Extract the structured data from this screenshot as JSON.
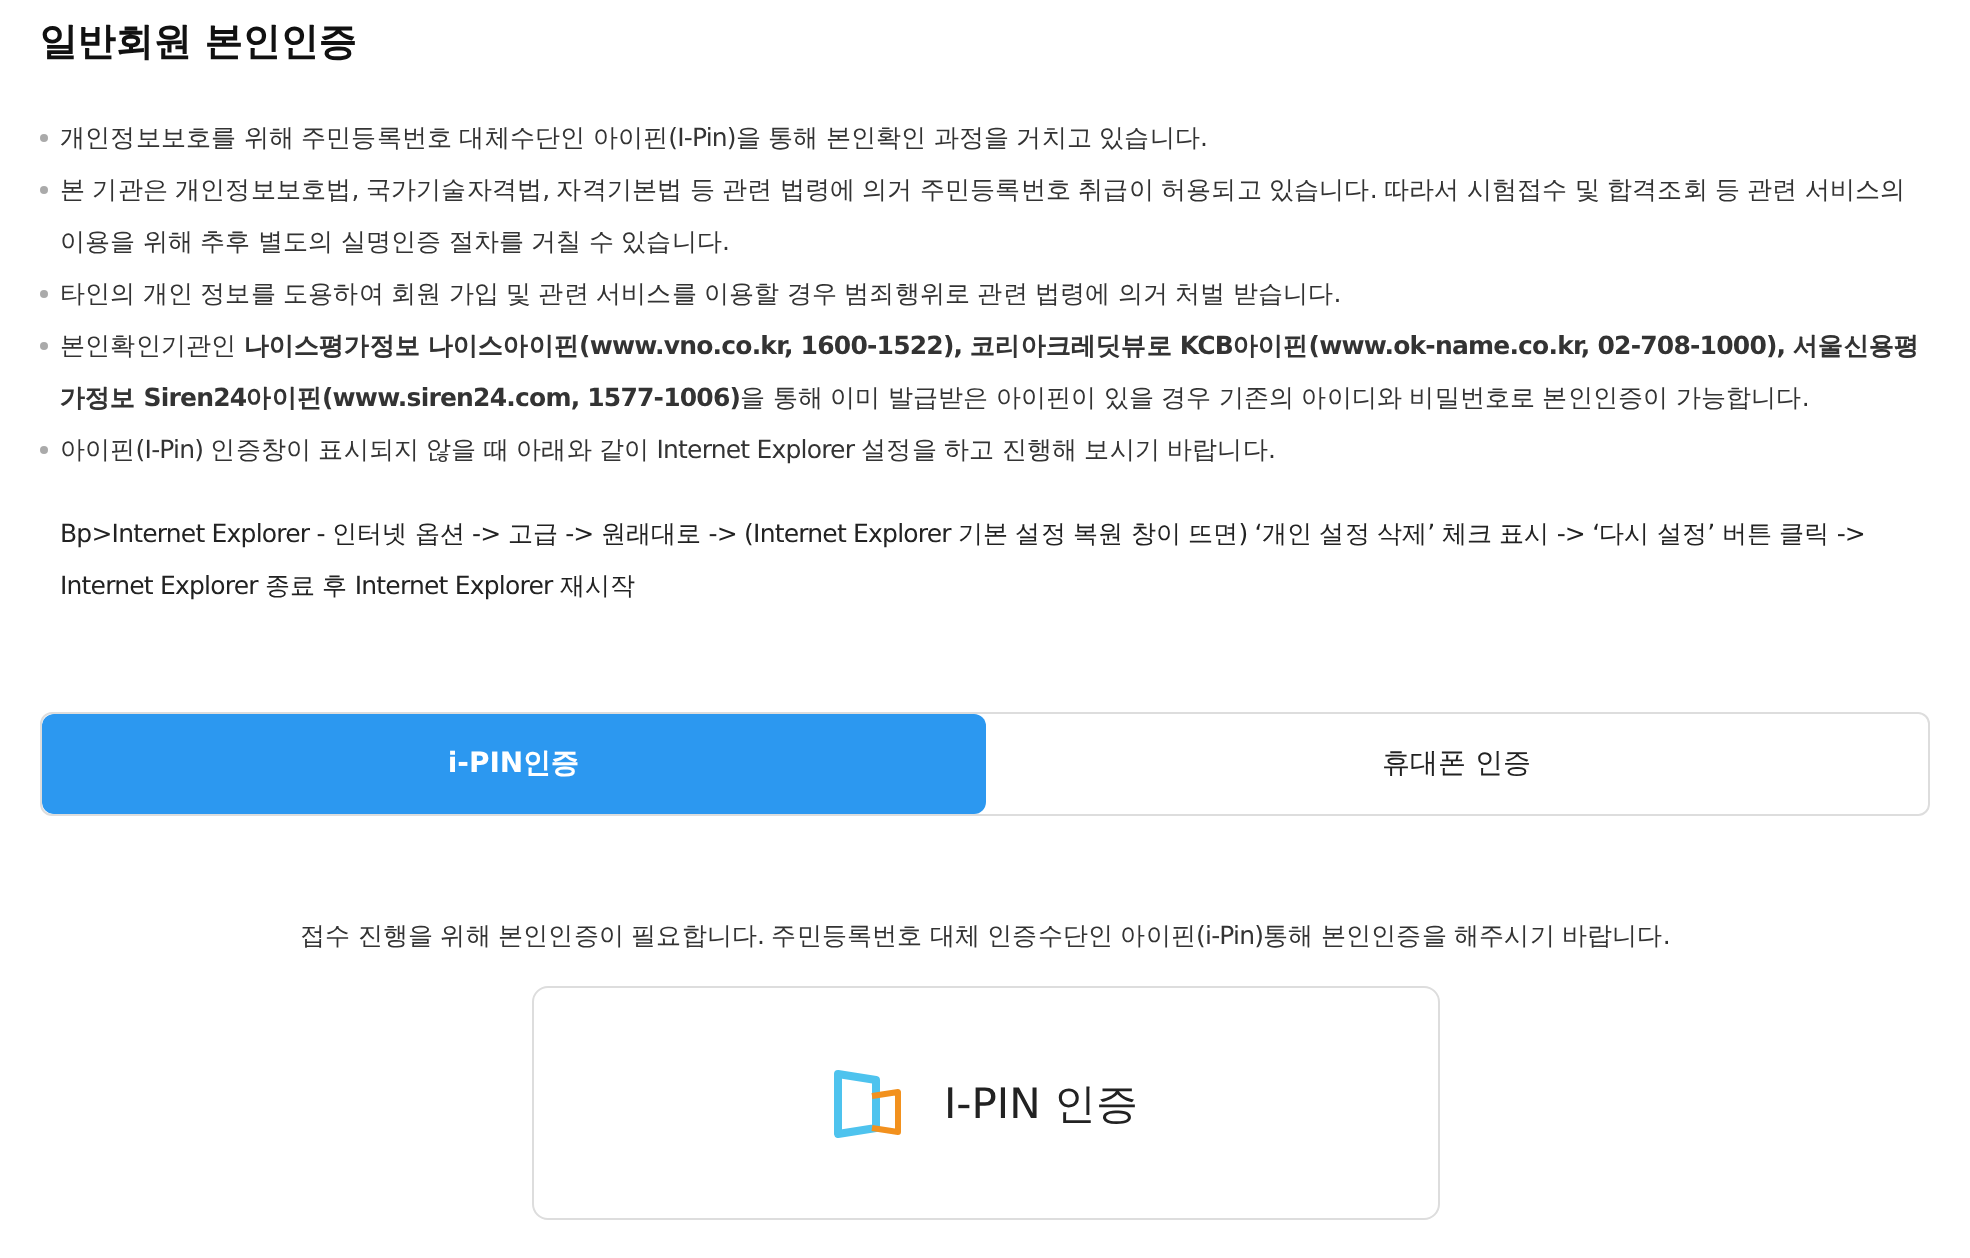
{
  "title": "일반회원 본인인증",
  "notices": [
    "개인정보보호를 위해 주민등록번호 대체수단인 아이핀(I-Pin)을 통해 본인확인 과정을 거치고 있습니다.",
    "본 기관은 개인정보보호법, 국가기술자격법, 자격기본법 등 관련 법령에 의거 주민등록번호 취급이 허용되고 있습니다. 따라서 시험접수 및 합격조회 등 관련 서비스의 이용을 위해 추후 별도의 실명인증 절차를 거칠 수 있습니다.",
    "타인의 개인 정보를 도용하여 회원 가입 및 관련 서비스를 이용할 경우 범죄행위로 관련 법령에 의거 처벌 받습니다.",
    "본인확인기관인 **나이스평가정보 나이스아이핀(www.vno.co.kr, 1600-1522), 코리아크레딧뷰로 KCB아이핀(www.ok-name.co.kr, 02-708-1000), 서울신용평가정보 Siren24아이핀(www.siren24.com, 1577-1006)**을 통해 이미 발급받은 아이핀이 있을 경우 기존의 아이디와 비밀번호로 본인인증이 가능합니다.",
    "아이핀(I-Pin) 인증창이 표시되지 않을 때 아래와 같이 Internet Explorer 설정을 하고 진행해 보시기 바랍니다."
  ],
  "guide": "Bp>Internet Explorer - 인터넷 옵션 -> 고급 -> 원래대로 -> (Internet Explorer 기본 설정 복원 창이 뜨면) ‘개인 설정 삭제’ 체크 표시 -> ‘다시 설정’ 버튼 클릭 -> Internet Explorer 종료 후 Internet Explorer 재시작",
  "tabs": [
    {
      "label": "i-PIN인증",
      "selected": true
    },
    {
      "label": "휴대폰 인증",
      "selected": false
    }
  ],
  "instruction": "접수 진행을 위해 본인인증이 필요합니다. 주민등록번호 대체 인증수단인 아이핀(i-Pin)통해 본인인증을 해주시기 바랍니다.",
  "ipin_button": "I-PIN 인증"
}
